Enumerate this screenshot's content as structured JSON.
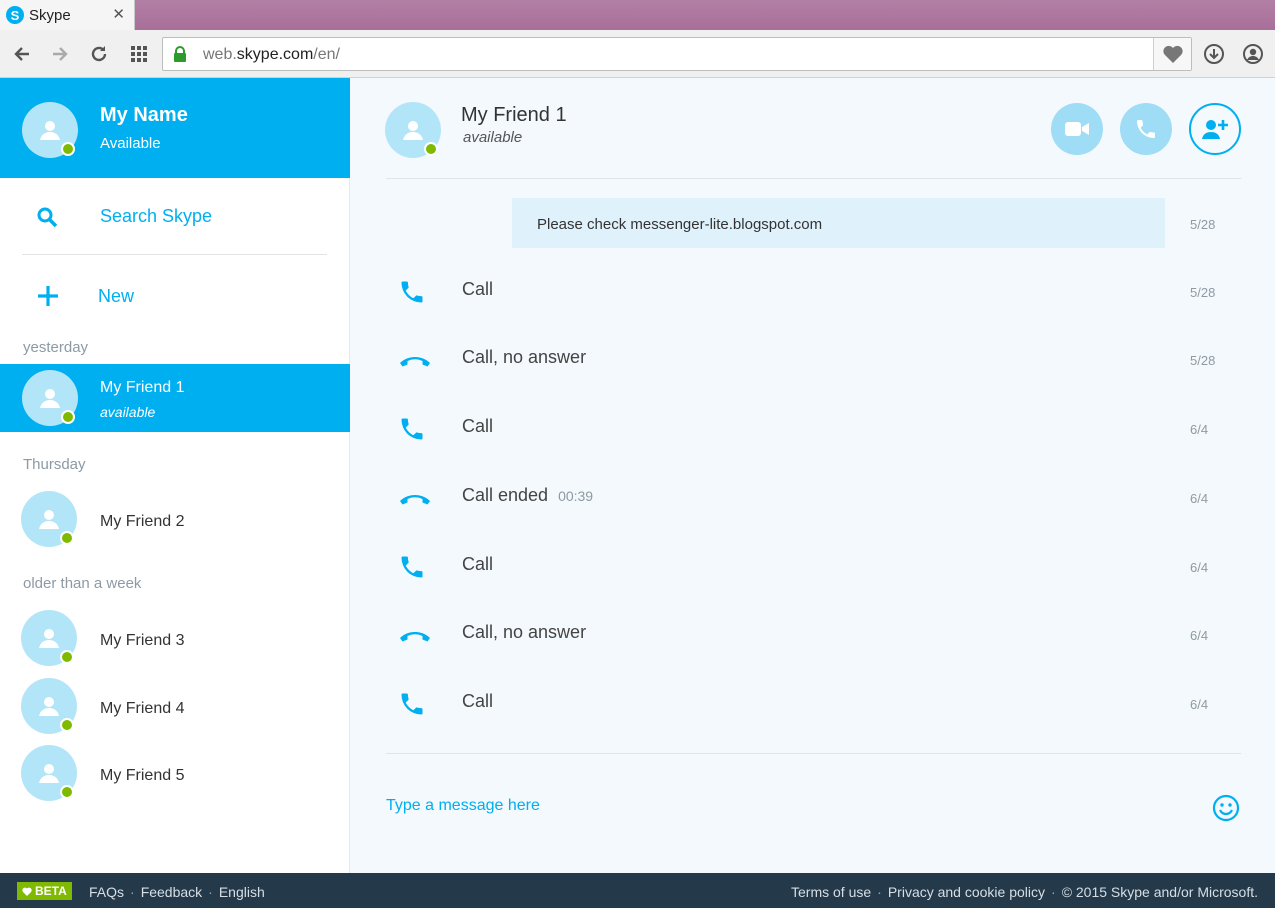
{
  "browser": {
    "tab_title": "Skype",
    "tab_logo": "S",
    "tab_close": "✕",
    "url_domain": "web.",
    "url_host": "skype.com",
    "url_path": "/en/"
  },
  "colors": {
    "accent": "#00aff0",
    "presence": "#7fba00",
    "footer": "#24394a"
  },
  "me": {
    "name": "My Name",
    "status": "Available"
  },
  "sidebar": {
    "search_label": "Search Skype",
    "new_label": "New"
  },
  "groups": [
    {
      "label": "yesterday"
    },
    {
      "label": "Thursday"
    },
    {
      "label": "older than a week"
    }
  ],
  "contacts": [
    {
      "name": "My Friend 1",
      "status": "available"
    },
    {
      "name": "My Friend 2"
    },
    {
      "name": "My Friend 3"
    },
    {
      "name": "My Friend 4"
    },
    {
      "name": "My Friend 5"
    }
  ],
  "chat": {
    "name": "My Friend 1",
    "status": "available",
    "message": {
      "text": "Please check messenger-lite.blogspot.com",
      "date": "5/28"
    },
    "events": [
      {
        "icon": "phone-icon",
        "text": "Call",
        "duration": "",
        "date": "5/28"
      },
      {
        "icon": "hang-up-icon",
        "text": "Call, no answer",
        "duration": "",
        "date": "5/28"
      },
      {
        "icon": "phone-icon",
        "text": "Call",
        "duration": "",
        "date": "6/4"
      },
      {
        "icon": "hang-up-icon",
        "text": "Call ended",
        "duration": "00:39",
        "date": "6/4"
      },
      {
        "icon": "phone-icon",
        "text": "Call",
        "duration": "",
        "date": "6/4"
      },
      {
        "icon": "hang-up-icon",
        "text": "Call, no answer",
        "duration": "",
        "date": "6/4"
      },
      {
        "icon": "phone-icon",
        "text": "Call",
        "duration": "",
        "date": "6/4"
      }
    ],
    "input_placeholder": "Type a message here"
  },
  "footer": {
    "beta": "BETA",
    "faqs": "FAQs",
    "feedback": "Feedback",
    "language": "English",
    "terms": "Terms of use",
    "privacy": "Privacy and cookie policy",
    "copyright": "© 2015 Skype and/or Microsoft.",
    "separator": "·"
  }
}
